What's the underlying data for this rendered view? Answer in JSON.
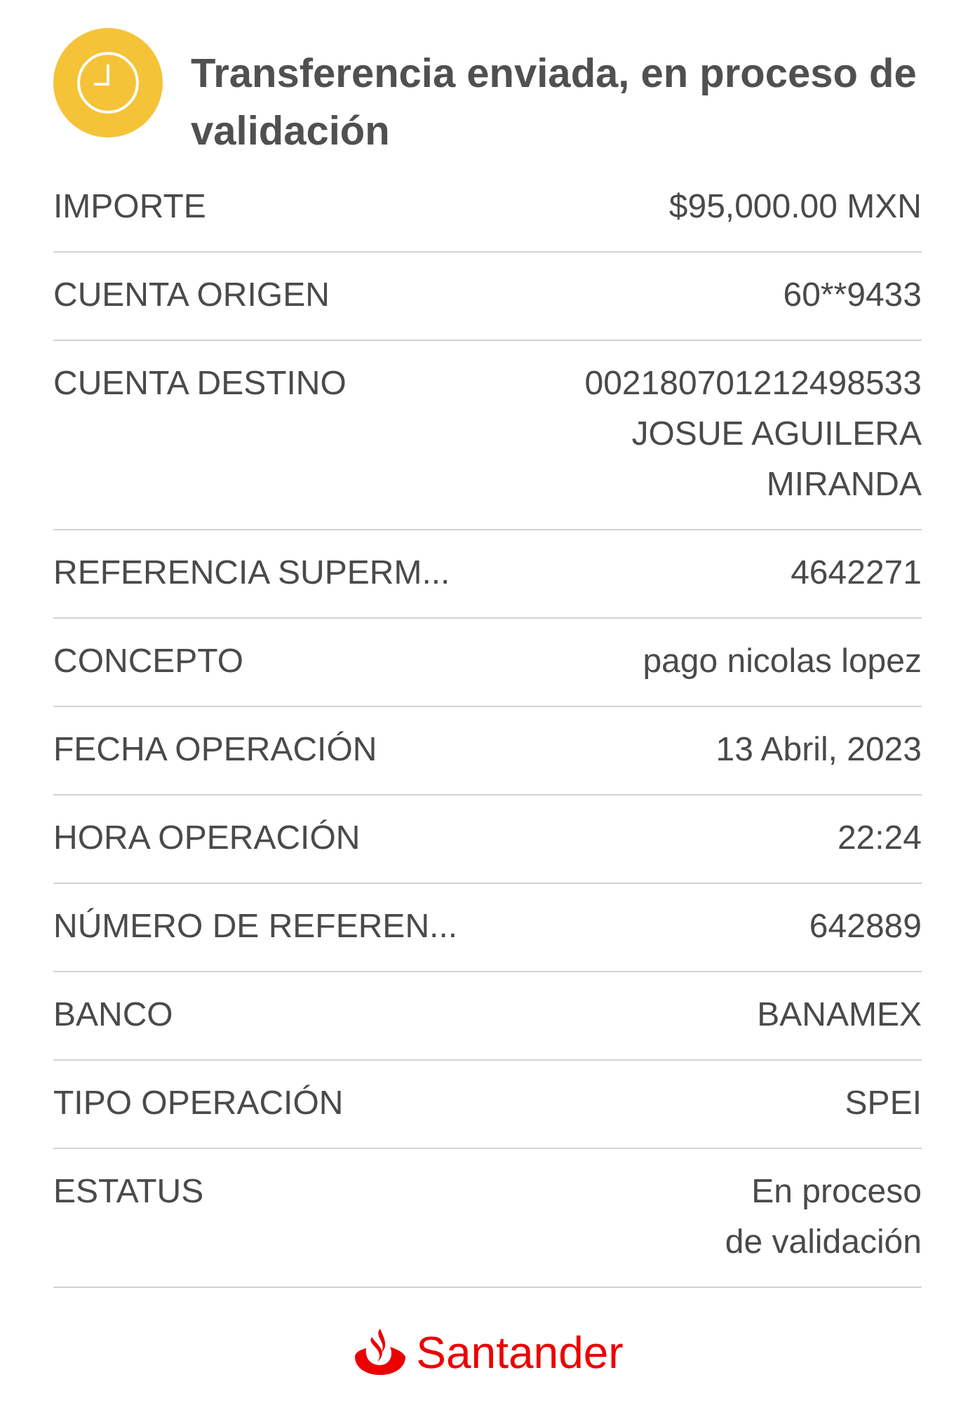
{
  "header": {
    "title": "Transferencia enviada, en proceso de validación"
  },
  "rows": [
    {
      "label": "IMPORTE",
      "value": [
        "$95,000.00 MXN"
      ]
    },
    {
      "label": "CUENTA ORIGEN",
      "value": [
        "60**9433"
      ]
    },
    {
      "label": "CUENTA DESTINO",
      "value": [
        "002180701212498533",
        "JOSUE AGUILERA",
        "MIRANDA"
      ]
    },
    {
      "label": "REFERENCIA SUPERM...",
      "value": [
        "4642271"
      ]
    },
    {
      "label": "CONCEPTO",
      "value": [
        "pago nicolas lopez"
      ]
    },
    {
      "label": "FECHA OPERACIÓN",
      "value": [
        "13 Abril, 2023"
      ]
    },
    {
      "label": "HORA OPERACIÓN",
      "value": [
        "22:24"
      ]
    },
    {
      "label": "NÚMERO DE REFEREN...",
      "value": [
        "642889"
      ]
    },
    {
      "label": "BANCO",
      "value": [
        "BANAMEX"
      ]
    },
    {
      "label": "TIPO OPERACIÓN",
      "value": [
        "SPEI"
      ]
    },
    {
      "label": "ESTATUS",
      "value": [
        "En proceso",
        "de validación"
      ]
    }
  ],
  "footer": {
    "brand": "Santander"
  }
}
